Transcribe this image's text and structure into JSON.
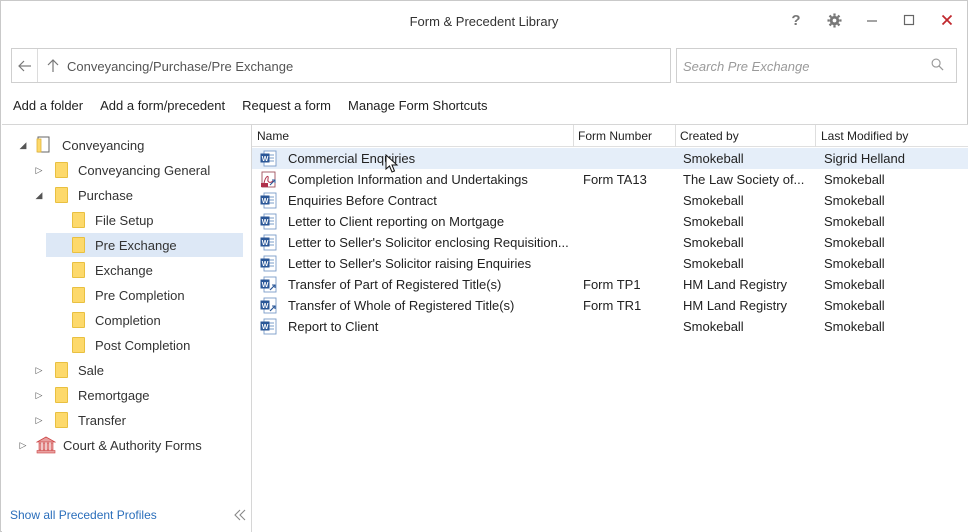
{
  "window": {
    "title": "Form & Precedent Library"
  },
  "titlebar": {
    "help": "?"
  },
  "address": {
    "path": "Conveyancing/Purchase/Pre Exchange"
  },
  "search": {
    "placeholder": "Search Pre Exchange"
  },
  "toolbar": {
    "add_folder": "Add a folder",
    "add_form": "Add a form/precedent",
    "request_form": "Request a form",
    "manage_shortcuts": "Manage Form Shortcuts"
  },
  "tree": {
    "conveyancing": "Conveyancing",
    "conveyancing_general": "Conveyancing General",
    "purchase": "Purchase",
    "file_setup": "File Setup",
    "pre_exchange": "Pre Exchange",
    "exchange": "Exchange",
    "pre_completion": "Pre Completion",
    "completion": "Completion",
    "post_completion": "Post Completion",
    "sale": "Sale",
    "remortgage": "Remortgage",
    "transfer": "Transfer",
    "court_forms": "Court & Authority Forms"
  },
  "footer": {
    "show_all": "Show all Precedent Profiles",
    "collapse": "«"
  },
  "grid": {
    "headers": {
      "name": "Name",
      "form_number": "Form Number",
      "created_by": "Created by",
      "last_modified_by": "Last Modified by"
    },
    "rows": [
      {
        "name": "Commercial Enquiries",
        "form": "",
        "created": "Smokeball",
        "modified": "Sigrid Helland",
        "icon": "word-doc-icon"
      },
      {
        "name": "Completion Information and Undertakings",
        "form": "Form TA13",
        "created": "The Law Society of...",
        "modified": "Smokeball",
        "icon": "pdf-form-icon"
      },
      {
        "name": "Enquiries Before Contract",
        "form": "",
        "created": "Smokeball",
        "modified": "Smokeball",
        "icon": "word-doc-icon"
      },
      {
        "name": "Letter to Client reporting on Mortgage",
        "form": "",
        "created": "Smokeball",
        "modified": "Smokeball",
        "icon": "word-doc-icon"
      },
      {
        "name": "Letter to Seller's Solicitor enclosing Requisition...",
        "form": "",
        "created": "Smokeball",
        "modified": "Smokeball",
        "icon": "word-doc-icon"
      },
      {
        "name": "Letter to Seller's Solicitor raising Enquiries",
        "form": "",
        "created": "Smokeball",
        "modified": "Smokeball",
        "icon": "word-doc-icon"
      },
      {
        "name": "Transfer of Part of Registered Title(s)",
        "form": "Form TP1",
        "created": "HM Land Registry",
        "modified": "Smokeball",
        "icon": "word-form-icon"
      },
      {
        "name": "Transfer of Whole of Registered Title(s)",
        "form": "Form TR1",
        "created": "HM Land Registry",
        "modified": "Smokeball",
        "icon": "word-form-icon"
      },
      {
        "name": "Report to Client",
        "form": "",
        "created": "Smokeball",
        "modified": "Smokeball",
        "icon": "word-doc-icon"
      }
    ]
  },
  "colors": {
    "selection": "#dde8f6",
    "link": "#2a6ebb",
    "folder": "#fdd96b",
    "word": "#2b5797"
  }
}
